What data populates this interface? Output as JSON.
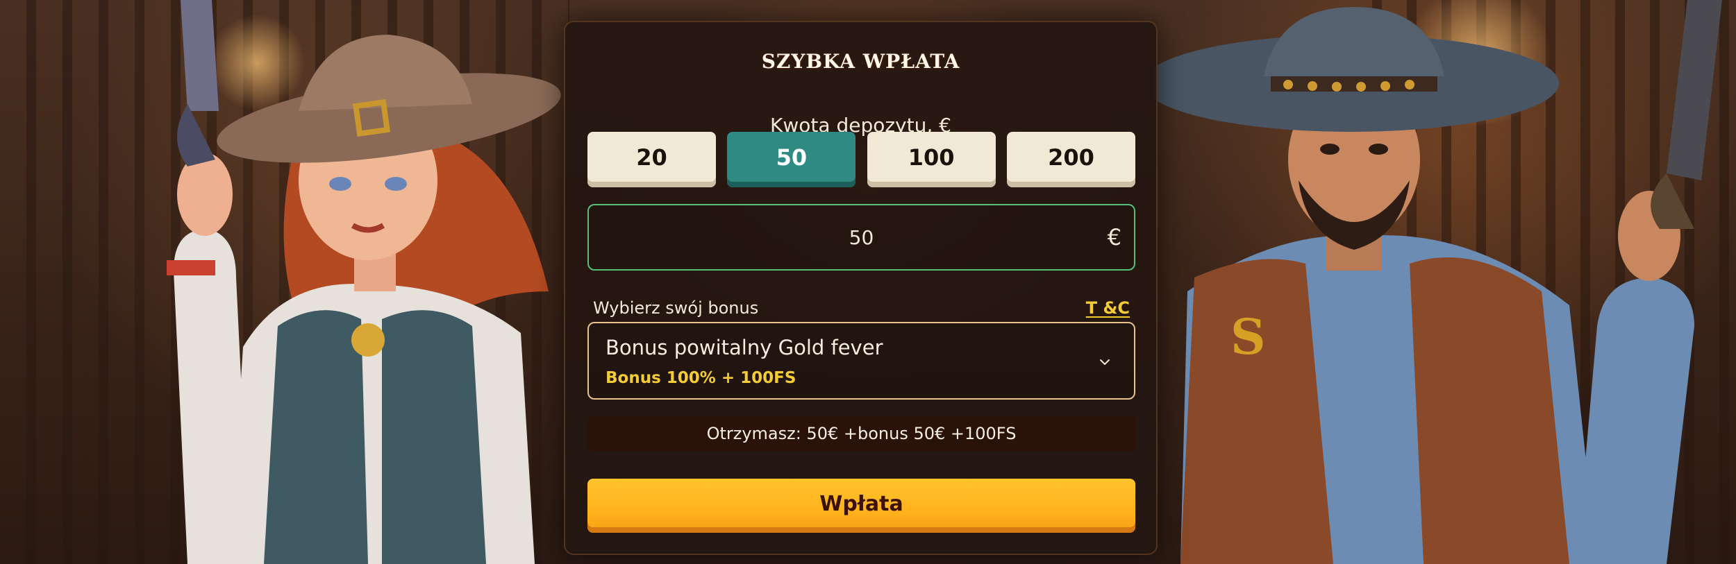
{
  "panel": {
    "title": "SZYBKA WPŁATA",
    "amount_label": "Kwota depozytu, €",
    "amounts": [
      "20",
      "50",
      "100",
      "200"
    ],
    "selected_amount_index": 1,
    "amount_input_value": "50",
    "currency_symbol": "€",
    "bonus_label": "Wybierz swój bonus",
    "tc_link": "T &C",
    "bonus": {
      "name": "Bonus powitalny Gold fever",
      "subtitle": "Bonus 100% + 100FS"
    },
    "receive_text": "Otrzymasz: 50€ +bonus 50€ +100FS",
    "submit_label": "Wpłata"
  },
  "colors": {
    "active_amount": "#2e8a83",
    "input_border": "#56c07a",
    "bonus_border": "#e6c48a",
    "accent_yellow": "#f5cc32",
    "submit_button": "#ffb21e"
  },
  "icons": {
    "bonus_dropdown": "chevron-down-icon"
  }
}
